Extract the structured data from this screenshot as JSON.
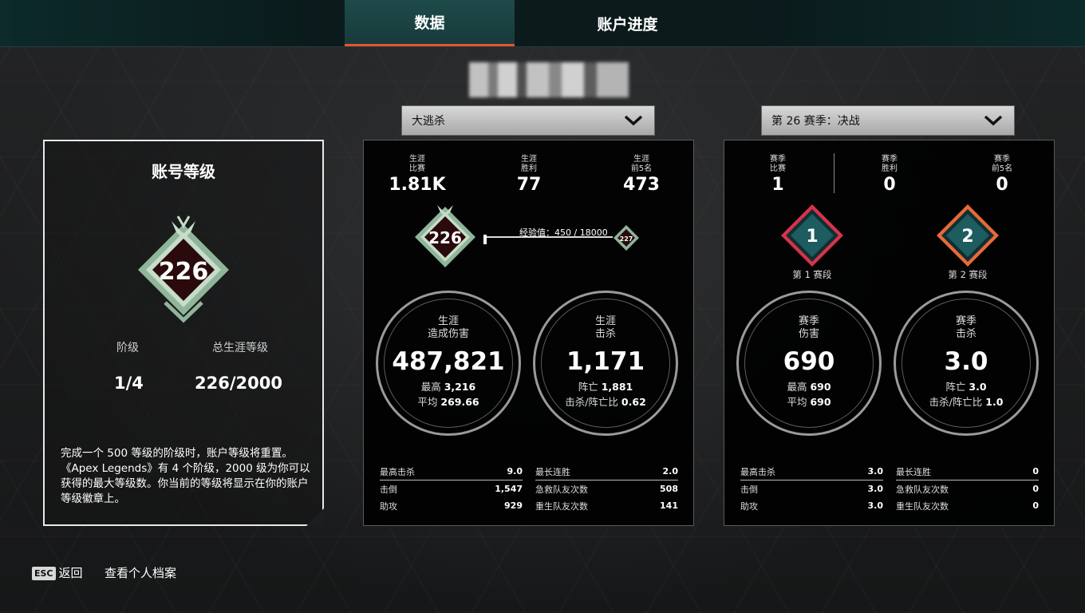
{
  "tabs": [
    {
      "label": "数据",
      "active": true
    },
    {
      "label": "账户进度",
      "active": false
    }
  ],
  "dropdowns": {
    "mode": "大逃杀",
    "season": "第 26 赛季：决战"
  },
  "account": {
    "title": "账号等级",
    "badge_level": "226",
    "tier_label": "阶级",
    "total_label": "总生涯等级",
    "tier_value": "1/4",
    "total_value": "226/2000",
    "description": "完成一个 500 等级的阶级时，账户等级将重置。《Apex Legends》有 4 个阶级，2000 级为你可以获得的最大等级数。你当前的等级将显示在你的账户等级徽章上。"
  },
  "career": {
    "heads": [
      {
        "l1": "生涯",
        "l2": "比赛",
        "value": "1.81K"
      },
      {
        "l1": "生涯",
        "l2": "胜利",
        "value": "77"
      },
      {
        "l1": "生涯",
        "l2": "前5名",
        "value": "473"
      }
    ],
    "badge_level": "226",
    "next_badge_level": "227",
    "xp_label": "经验值：450 / 18000",
    "xp_progress": 0.025,
    "damage": {
      "t1": "生涯",
      "t2": "造成伤害",
      "value": "487,821",
      "s1k": "最高",
      "s1v": "3,216",
      "s2k": "平均",
      "s2v": "269.66"
    },
    "kills": {
      "t1": "生涯",
      "t2": "击杀",
      "value": "1,171",
      "s1k": "阵亡",
      "s1v": "1,881",
      "s2k": "击杀/阵亡比",
      "s2v": "0.62"
    },
    "table_left": [
      {
        "k": "最高击杀",
        "v": "9.0"
      },
      {
        "k": "击倒",
        "v": "1,547"
      },
      {
        "k": "助攻",
        "v": "929"
      }
    ],
    "table_right": [
      {
        "k": "最长连胜",
        "v": "2.0"
      },
      {
        "k": "急救队友次数",
        "v": "508"
      },
      {
        "k": "重生队友次数",
        "v": "141"
      }
    ]
  },
  "season": {
    "heads": [
      {
        "l1": "赛季",
        "l2": "比赛",
        "value": "1"
      },
      {
        "l1": "赛季",
        "l2": "胜利",
        "value": "0"
      },
      {
        "l1": "赛季",
        "l2": "前5名",
        "value": "0"
      }
    ],
    "split1": {
      "num": "1",
      "label": "第 1 赛段",
      "color": "#d8334a"
    },
    "split2": {
      "num": "2",
      "label": "第 2 赛段",
      "color": "#e8693a"
    },
    "damage": {
      "t1": "赛季",
      "t2": "伤害",
      "value": "690",
      "s1k": "最高",
      "s1v": "690",
      "s2k": "平均",
      "s2v": "690"
    },
    "kills": {
      "t1": "赛季",
      "t2": "击杀",
      "value": "3.0",
      "s1k": "阵亡",
      "s1v": "3.0",
      "s2k": "击杀/阵亡比",
      "s2v": "1.0"
    },
    "table_left": [
      {
        "k": "最高击杀",
        "v": "3.0"
      },
      {
        "k": "击倒",
        "v": "3.0"
      },
      {
        "k": "助攻",
        "v": "3.0"
      }
    ],
    "table_right": [
      {
        "k": "最长连胜",
        "v": "0"
      },
      {
        "k": "急救队友次数",
        "v": "0"
      },
      {
        "k": "重生队友次数",
        "v": "0"
      }
    ]
  },
  "footer": {
    "esc_key": "ESC",
    "back": "返回",
    "profile": "查看个人档案"
  }
}
